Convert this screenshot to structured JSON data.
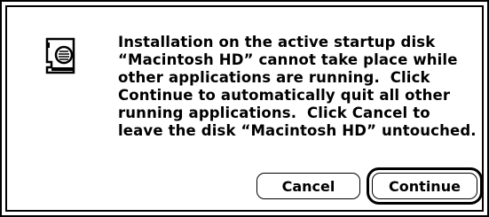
{
  "dialog": {
    "icon": "caution-speech-document-icon",
    "message": "Installation on the active startup disk\n“Macintosh HD” cannot take place while\nother applications are running.  Click\nContinue to automatically quit all other\nrunning applications.  Click Cancel to\nleave the disk “Macintosh HD” untouched.",
    "buttons": {
      "cancel_label": "Cancel",
      "continue_label": "Continue"
    },
    "default_button": "continue"
  }
}
